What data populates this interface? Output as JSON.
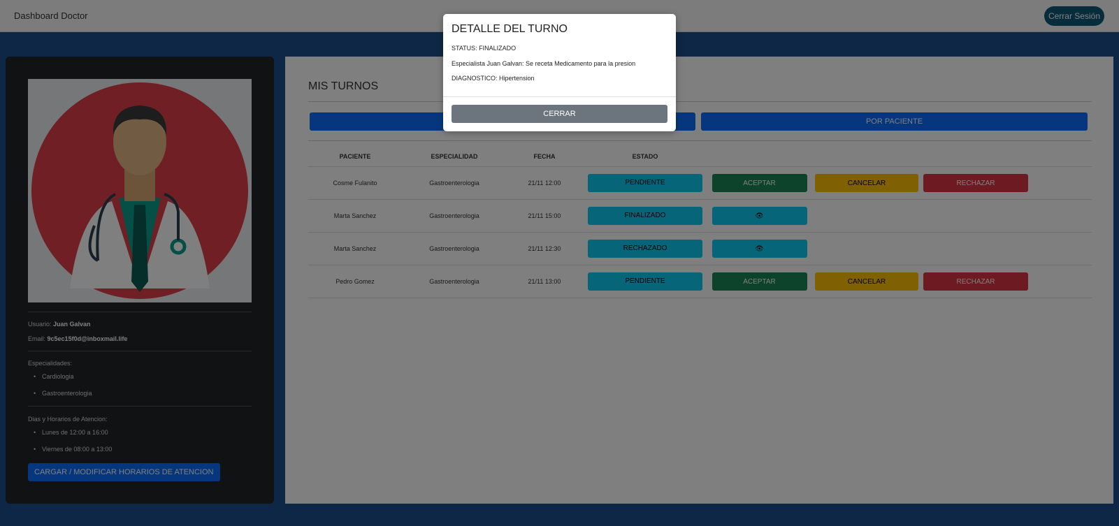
{
  "navbar": {
    "brand": "Dashboard Doctor",
    "logout_label": "Cerrar Sesión"
  },
  "profile": {
    "user_label": "Usuario:",
    "user_value": "Juan Galvan",
    "email_label": "Email:",
    "email_value": "9c5ec15f0d@inboxmail.life",
    "specialties_label": "Especialidades:",
    "specialties": [
      "Cardiologia",
      "Gastroenterologia"
    ],
    "schedule_label": "Dias y Horarios de Atencion:",
    "schedule": [
      "Lunes de 12:00 a 16:00",
      "Viernes de 08:00 a 13:00"
    ],
    "edit_schedule_label": "CARGAR / MODIFICAR HORARIOS DE ATENCION"
  },
  "main": {
    "title": "MIS TURNOS",
    "filter_by_specialty_label": "",
    "filter_by_patient_label": "POR PACIENTE",
    "columns": [
      "PACIENTE",
      "ESPECIALIDAD",
      "FECHA",
      "ESTADO"
    ],
    "rows": [
      {
        "patient": "Cosme Fulanito",
        "specialty": "Gastroenterologia",
        "date": "21/11 12:00",
        "status": "PENDIENTE",
        "actions": [
          "ACEPTAR",
          "CANCELAR",
          "RECHAZAR"
        ]
      },
      {
        "patient": "Marta Sanchez",
        "specialty": "Gastroenterologia",
        "date": "21/11 15:00",
        "status": "FINALIZADO",
        "actions": [
          "view"
        ]
      },
      {
        "patient": "Marta Sanchez",
        "specialty": "Gastroenterologia",
        "date": "21/11 12:30",
        "status": "RECHAZADO",
        "actions": [
          "view"
        ]
      },
      {
        "patient": "Pedro Gomez",
        "specialty": "Gastroenterologia",
        "date": "21/11 13:00",
        "status": "PENDIENTE",
        "actions": [
          "ACEPTAR",
          "CANCELAR",
          "RECHAZAR"
        ]
      }
    ],
    "accept_label": "ACEPTAR",
    "cancel_label": "CANCELAR",
    "reject_label": "RECHAZAR",
    "view_icon": "eye-icon"
  },
  "modal": {
    "title": "DETALLE DEL TURNO",
    "status_line": "STATUS: FINALIZADO",
    "review_line": "Especialista Juan Galvan: Se receta Medicamento para la presion",
    "diagnosis_line": "DIAGNOSTICO: Hipertension",
    "close_label": "CERRAR"
  },
  "colors": {
    "primary": "#0d6efd",
    "info": "#0dcaf0",
    "success": "#198754",
    "warning": "#ffc107",
    "danger": "#dc3545",
    "secondary": "#6c757d",
    "logout": "#0f5a78",
    "dark": "#212529"
  }
}
